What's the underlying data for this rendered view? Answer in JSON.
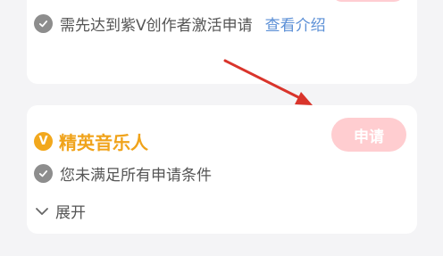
{
  "top_card": {
    "requirement_text": "需先达到紫V创作者激活申请",
    "link_text": "查看介绍"
  },
  "main_card": {
    "badge_letter": "V",
    "title": "精英音乐人",
    "apply_label": "申请",
    "condition_text": "您未满足所有申请条件",
    "expand_label": "展开"
  },
  "colors": {
    "accent_gold": "#f0a31a",
    "apply_button_bg": "#ffcdd0",
    "link_blue": "#5b8fd6",
    "annotation_arrow": "#d9342b"
  }
}
